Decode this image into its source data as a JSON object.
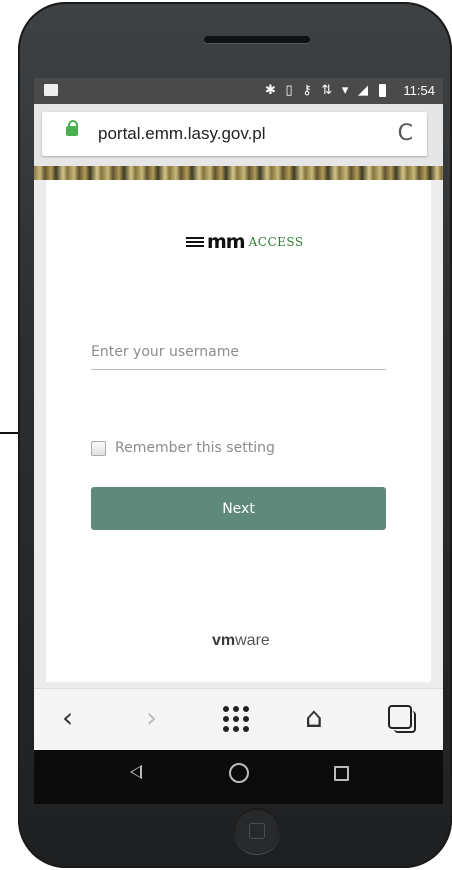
{
  "status_bar": {
    "time": "11:54",
    "icons": [
      "gallery-icon",
      "nfc-icon",
      "bluetooth-icon",
      "vibrate-icon",
      "vpn-key-icon",
      "data-icon",
      "wifi-icon",
      "signal-icon",
      "battery-icon"
    ]
  },
  "browser": {
    "url": "portal.emm.lasy.gov.pl",
    "reload_glyph": "C"
  },
  "login": {
    "logo_mm": "mm",
    "logo_access": "ACCESS",
    "username_placeholder": "Enter your username",
    "remember_label": "Remember this setting",
    "next_label": "Next",
    "footer_brand_bold": "vm",
    "footer_brand_rest": "ware"
  },
  "browser_nav": {
    "back_glyph": "‹",
    "forward_glyph": "›",
    "home_glyph": "⌂"
  }
}
